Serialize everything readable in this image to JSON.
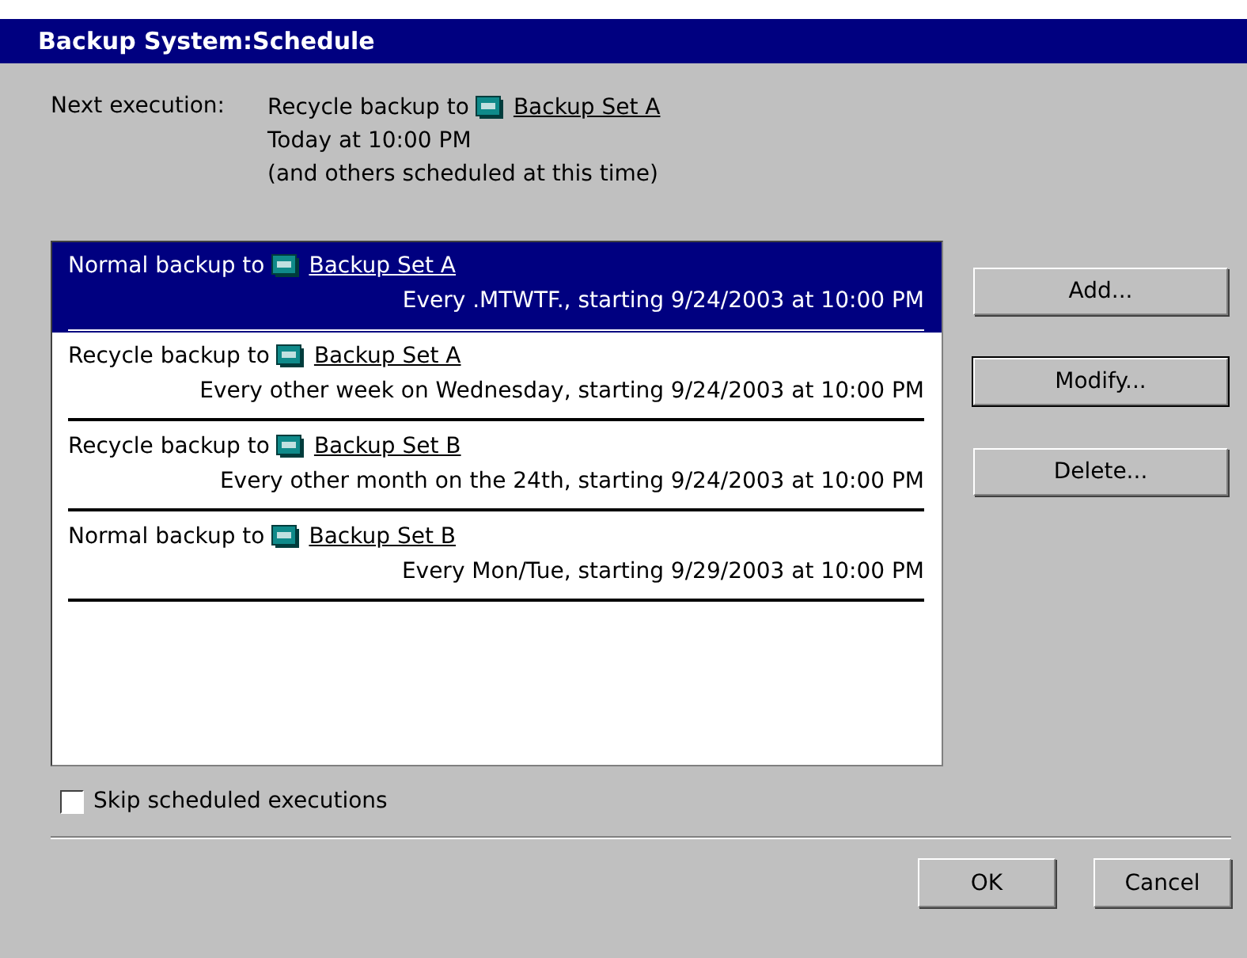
{
  "window": {
    "title": "Backup System:Schedule"
  },
  "next_execution": {
    "label": "Next execution:",
    "action": "Recycle backup to",
    "target": "Backup Set A",
    "time": "Today at 10:00 PM",
    "note": "(and others scheduled at this time)"
  },
  "schedules": [
    {
      "action": "Normal backup to",
      "target": "Backup Set A",
      "recurrence": "Every .MTWTF., starting 9/24/2003 at 10:00 PM",
      "selected": true
    },
    {
      "action": "Recycle backup to",
      "target": "Backup Set A",
      "recurrence": "Every other week on Wednesday, starting 9/24/2003 at 10:00 PM",
      "selected": false
    },
    {
      "action": "Recycle backup to",
      "target": "Backup Set B",
      "recurrence": "Every other month on the 24th, starting 9/24/2003 at 10:00 PM",
      "selected": false
    },
    {
      "action": "Normal backup to",
      "target": "Backup Set B",
      "recurrence": "Every Mon/Tue, starting 9/29/2003 at 10:00 PM",
      "selected": false
    }
  ],
  "side_buttons": [
    {
      "label": "Add...",
      "default": false
    },
    {
      "label": "Modify...",
      "default": true
    },
    {
      "label": "Delete...",
      "default": false
    }
  ],
  "skip_checkbox": {
    "label": "Skip scheduled executions",
    "checked": false
  },
  "footer_buttons": [
    {
      "label": "OK",
      "default": false
    },
    {
      "label": "Cancel",
      "default": false
    }
  ]
}
